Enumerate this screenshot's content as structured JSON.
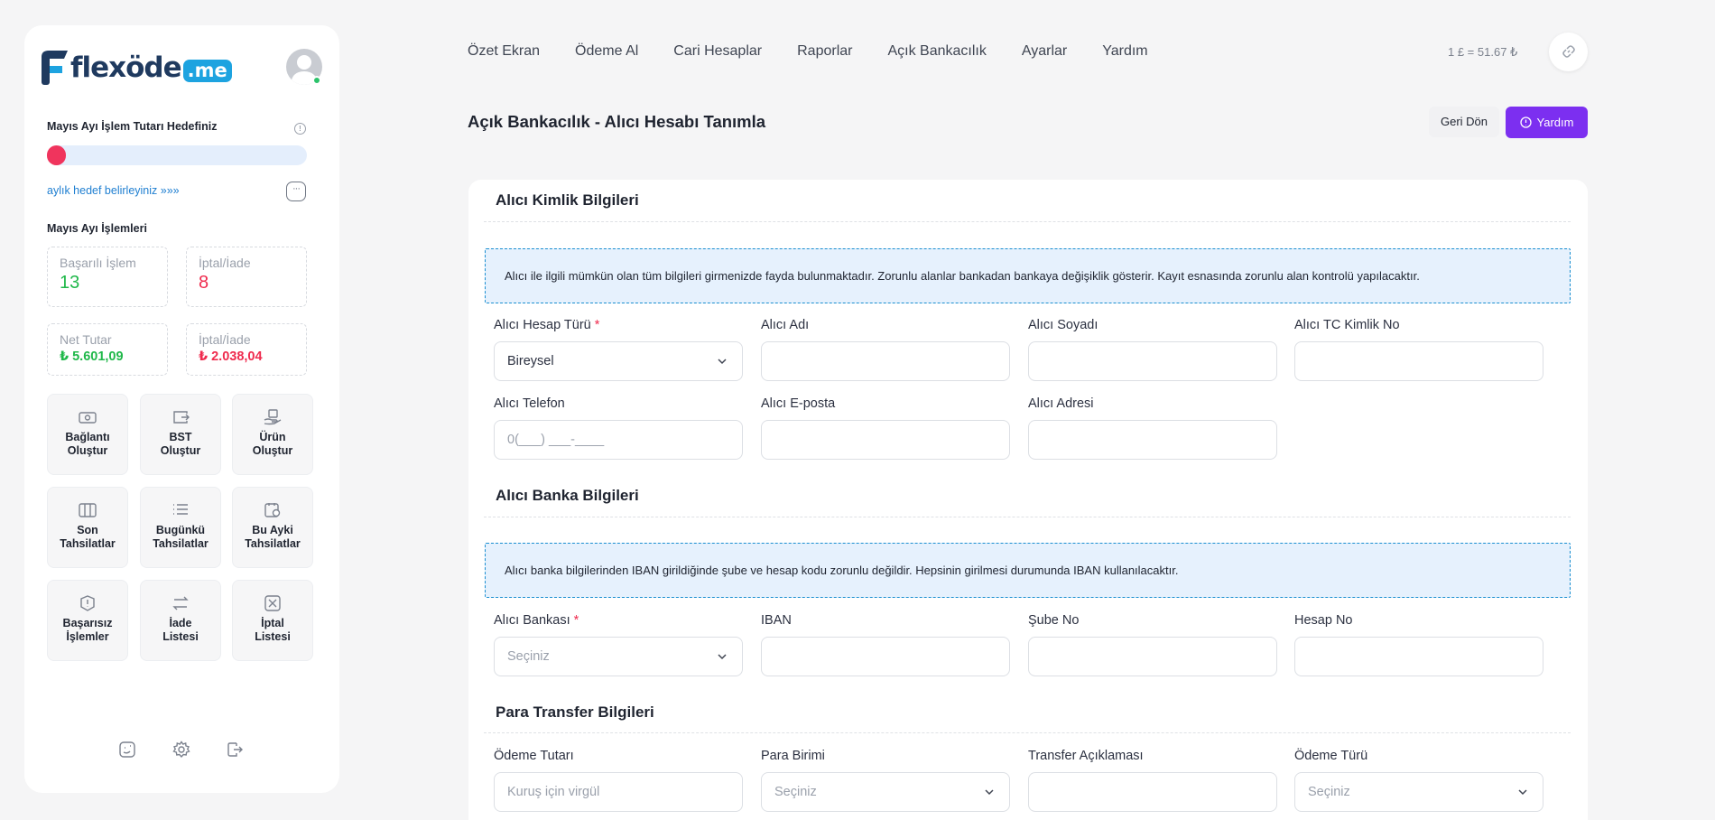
{
  "brand": {
    "name": "flexöde",
    "badge": ".me"
  },
  "sidebar": {
    "goal_title": "Mayıs Ayı İşlem Tutarı Hedefiniz",
    "goal_progress_percent": 0,
    "goal_link": "aylık hedef belirleyiniz »»»",
    "month_title": "Mayıs Ayı İşlemleri",
    "stats": [
      {
        "label": "Başarılı İşlem",
        "value": "13"
      },
      {
        "label": "İptal/İade",
        "value": "8"
      },
      {
        "label": "Net Tutar",
        "value": "₺ 5.601,09"
      },
      {
        "label": "İptal/İade",
        "value": "₺ 2.038,04"
      }
    ],
    "tiles": [
      {
        "label": "Bağlantı\nOluştur",
        "icon": "money-icon"
      },
      {
        "label": "BST\nOluştur",
        "icon": "wallet-icon"
      },
      {
        "label": "Ürün\nOluştur",
        "icon": "product-icon"
      },
      {
        "label": "Son\nTahsilatlar",
        "icon": "card-icon"
      },
      {
        "label": "Bugünkü\nTahsilatlar",
        "icon": "list-icon"
      },
      {
        "label": "Bu Ayki\nTahsilatlar",
        "icon": "calendar-icon"
      },
      {
        "label": "Başarısız\nİşlemler",
        "icon": "alert-icon"
      },
      {
        "label": "İade\nListesi",
        "icon": "refund-icon"
      },
      {
        "label": "İptal\nListesi",
        "icon": "cancel-icon"
      }
    ]
  },
  "nav": {
    "items": [
      "Özet Ekran",
      "Ödeme Al",
      "Cari Hesaplar",
      "Raporlar",
      "Açık Bankacılık",
      "Ayarlar",
      "Yardım"
    ],
    "rate": "1 £ = 51.67 ₺"
  },
  "page": {
    "title": "Açık Bankacılık - Alıcı Hesabı Tanımla",
    "back_label": "Geri Dön",
    "help_label": "Yardım"
  },
  "form": {
    "identity": {
      "title": "Alıcı Kimlik Bilgileri",
      "notice": "Alıcı ile ilgili mümkün olan tüm bilgileri girmenizde fayda bulunmaktadır. Zorunlu alanlar bankadan bankaya değişiklik gösterir. Kayıt esnasında zorunlu alan kontrolü yapılacaktır.",
      "account_type_label": "Alıcı Hesap Türü",
      "account_type_value": "Bireysel",
      "name_label": "Alıcı Adı",
      "surname_label": "Alıcı Soyadı",
      "tc_label": "Alıcı TC Kimlik No",
      "phone_label": "Alıcı Telefon",
      "phone_placeholder": "0(___) ___-____",
      "email_label": "Alıcı E-posta",
      "address_label": "Alıcı Adresi"
    },
    "bank": {
      "title": "Alıcı Banka Bilgileri",
      "notice": "Alıcı banka bilgilerinden IBAN girildiğinde şube ve hesap kodu zorunlu değildir. Hepsinin girilmesi durumunda IBAN kullanılacaktır.",
      "bank_label": "Alıcı Bankası",
      "bank_placeholder": "Seçiniz",
      "iban_label": "IBAN",
      "branch_label": "Şube No",
      "account_label": "Hesap No"
    },
    "transfer": {
      "title": "Para Transfer Bilgileri",
      "amount_label": "Ödeme Tutarı",
      "amount_placeholder": "Kuruş için virgül",
      "currency_label": "Para Birimi",
      "currency_placeholder": "Seçiniz",
      "description_label": "Transfer Açıklaması",
      "payment_type_label": "Ödeme Türü",
      "payment_type_placeholder": "Seçiniz"
    }
  }
}
